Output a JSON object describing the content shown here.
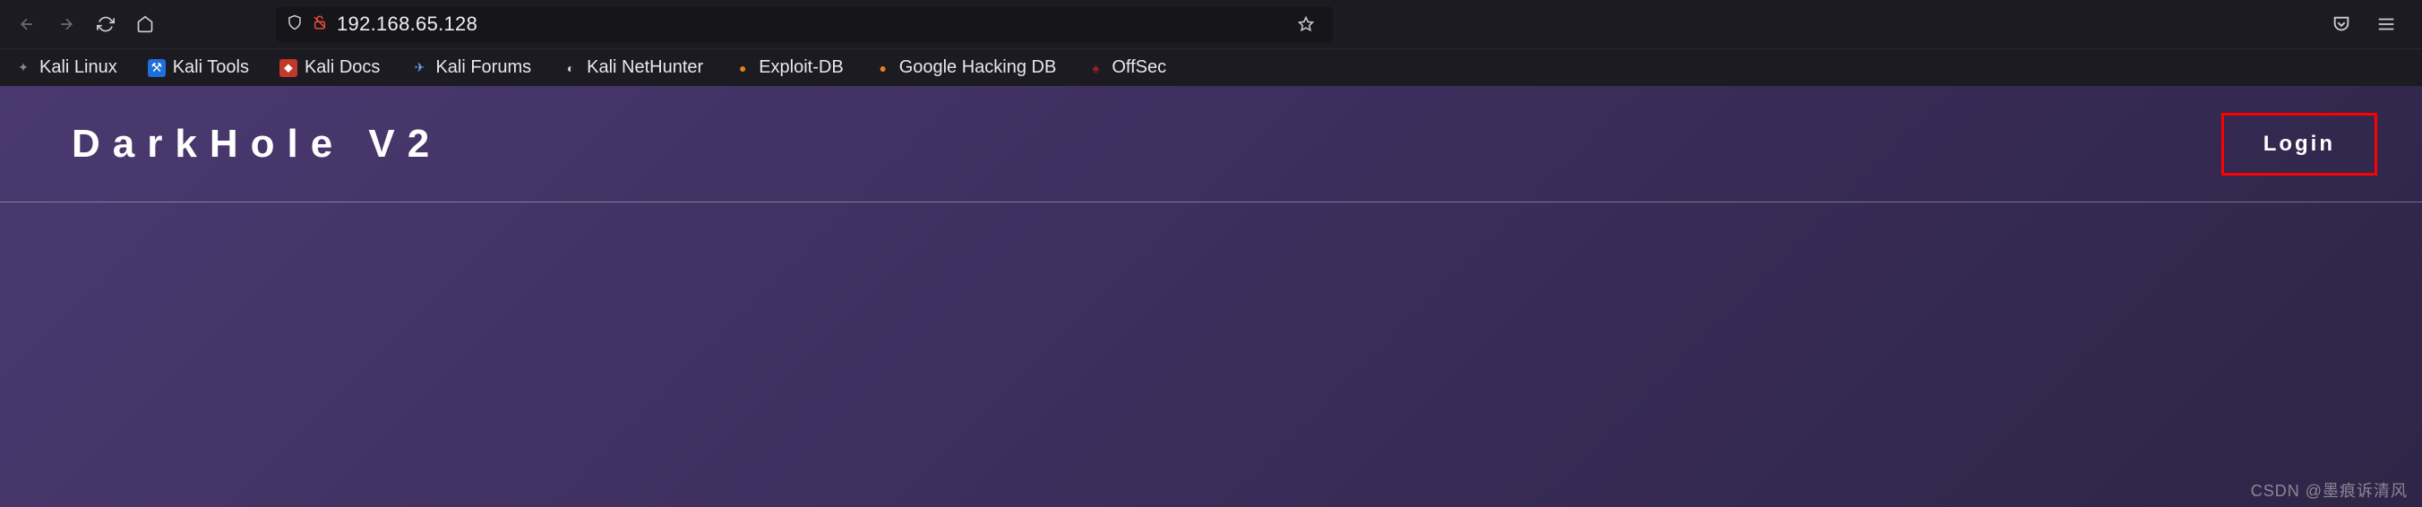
{
  "browser": {
    "url": "192.168.65.128"
  },
  "bookmarks": [
    {
      "label": "Kali Linux",
      "icon": "kali",
      "name": "bookmark-kali-linux"
    },
    {
      "label": "Kali Tools",
      "icon": "blue",
      "name": "bookmark-kali-tools"
    },
    {
      "label": "Kali Docs",
      "icon": "red",
      "name": "bookmark-kali-docs"
    },
    {
      "label": "Kali Forums",
      "icon": "forums",
      "name": "bookmark-kali-forums"
    },
    {
      "label": "Kali NetHunter",
      "icon": "nh",
      "name": "bookmark-kali-nethunter"
    },
    {
      "label": "Exploit-DB",
      "icon": "orange",
      "name": "bookmark-exploit-db"
    },
    {
      "label": "Google Hacking DB",
      "icon": "orange",
      "name": "bookmark-google-hacking-db"
    },
    {
      "label": "OffSec",
      "icon": "offsec",
      "name": "bookmark-offsec"
    }
  ],
  "page": {
    "title": "DarkHole V2",
    "login_label": "Login"
  },
  "watermark": "CSDN @墨痕诉清风"
}
